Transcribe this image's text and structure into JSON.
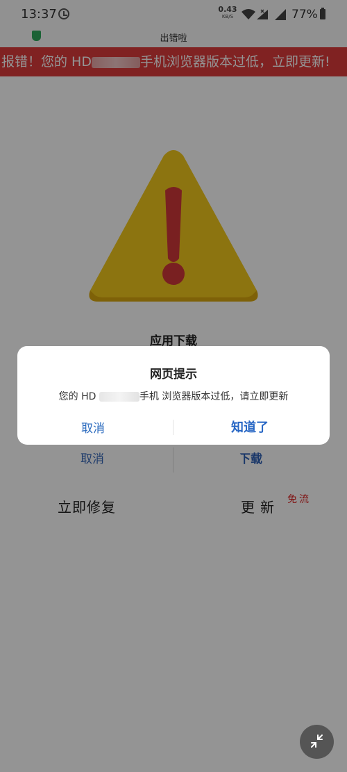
{
  "status_bar": {
    "time": "13:37",
    "net_speed": "0.43",
    "net_speed_unit": "KB/S",
    "battery": "77%"
  },
  "page": {
    "title": "出错啦"
  },
  "banner": {
    "prefix": "报错！您的 HD",
    "suffix": "手机浏览器版本过低，立即更新!"
  },
  "download_panel": {
    "title": "应用下载",
    "cancel_label": "取消",
    "download_label": "下载"
  },
  "actions": {
    "repair_label": "立即修复",
    "update_label": "更新",
    "free_tag": "免流"
  },
  "dialog": {
    "title": "网页提示",
    "message_prefix": "您的 HD",
    "message_suffix": "手机 浏览器版本过低，请立即更新",
    "cancel_label": "取消",
    "ok_label": "知道了"
  },
  "colors": {
    "banner": "#dd3b3b",
    "dialog_button": "#2d6cbf",
    "warning_triangle": "#f2c81d",
    "warning_mark": "#d0383a",
    "free_tag": "#dd2222"
  },
  "icons": {
    "alarm": "alarm-clock-icon",
    "wifi": "wifi-icon",
    "signal": "cell-signal-icon",
    "battery": "battery-icon",
    "shield": "shield-icon",
    "warning": "warning-triangle-icon",
    "collapse": "collapse-arrows-icon"
  }
}
